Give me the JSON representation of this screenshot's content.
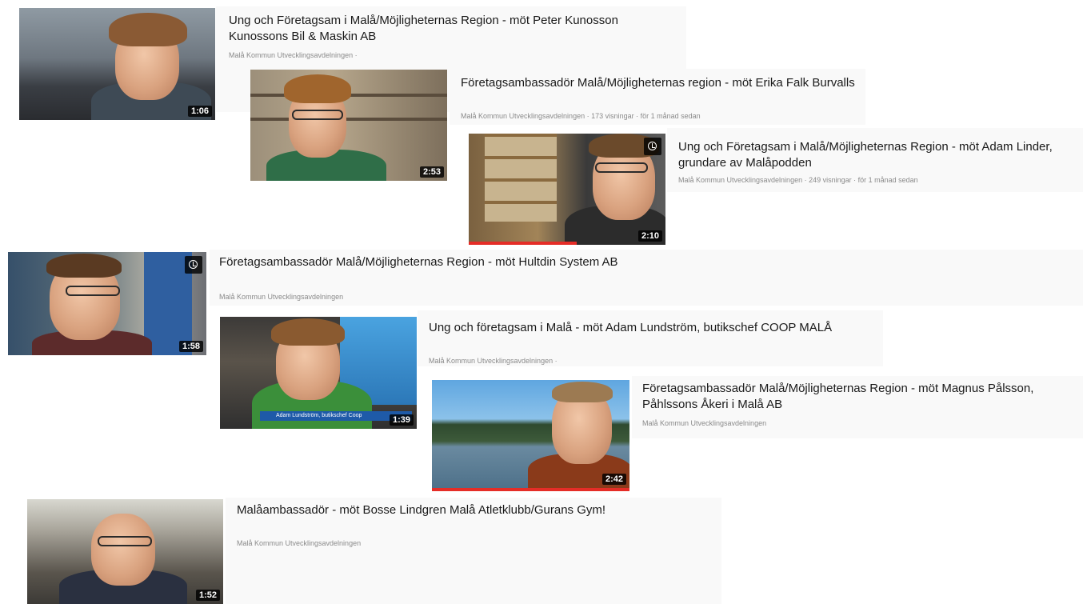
{
  "videos": [
    {
      "title": "Ung och Företagsam i Malå/Möjligheternas Region - möt Peter Kunosson Kunossons Bil & Maskin AB",
      "meta": "Malå Kommun Utvecklingsavdelningen ·",
      "duration": "1:06"
    },
    {
      "title": "Företagsambassadör Malå/Möjligheternas region - möt Erika Falk Burvalls",
      "meta": "Malå Kommun Utvecklingsavdelningen · 173 visningar · för 1 månad sedan",
      "duration": "2:53"
    },
    {
      "title": "Ung och Företagsam i Malå/Möjligheternas Region - möt Adam Linder, grundare av Malåpodden",
      "meta": "Malå Kommun Utvecklingsavdelningen · 249 visningar · för 1 månad sedan",
      "duration": "2:10",
      "watch_progress": 0.55
    },
    {
      "title": "Företagsambassadör Malå/Möjligheternas Region - möt Hultdin System AB",
      "meta": "Malå Kommun Utvecklingsavdelningen",
      "duration": "1:58"
    },
    {
      "title": "Ung och företagsam i Malå - möt Adam Lundström, butikschef COOP MALÅ",
      "meta": "Malå Kommun Utvecklingsavdelningen ·",
      "duration": "1:39",
      "lower_third": "Adam Lundström, butikschef Coop"
    },
    {
      "title": "Företagsambassadör Malå/Möjligheternas Region - möt Magnus Pålsson, Påhlssons Åkeri i Malå AB",
      "meta": "Malå Kommun Utvecklingsavdelningen",
      "duration": "2:42",
      "watch_progress": 1.0
    },
    {
      "title": "Malåambassadör - möt Bosse Lindgren Malå Atletklubb/Gurans Gym!",
      "meta": "Malå Kommun Utvecklingsavdelningen",
      "duration": "1:52"
    }
  ],
  "icons": {
    "watch_later": "clock-icon"
  },
  "colors": {
    "progress": "#e52d27",
    "title": "#1a1a1a",
    "meta": "#8a8a8a"
  }
}
